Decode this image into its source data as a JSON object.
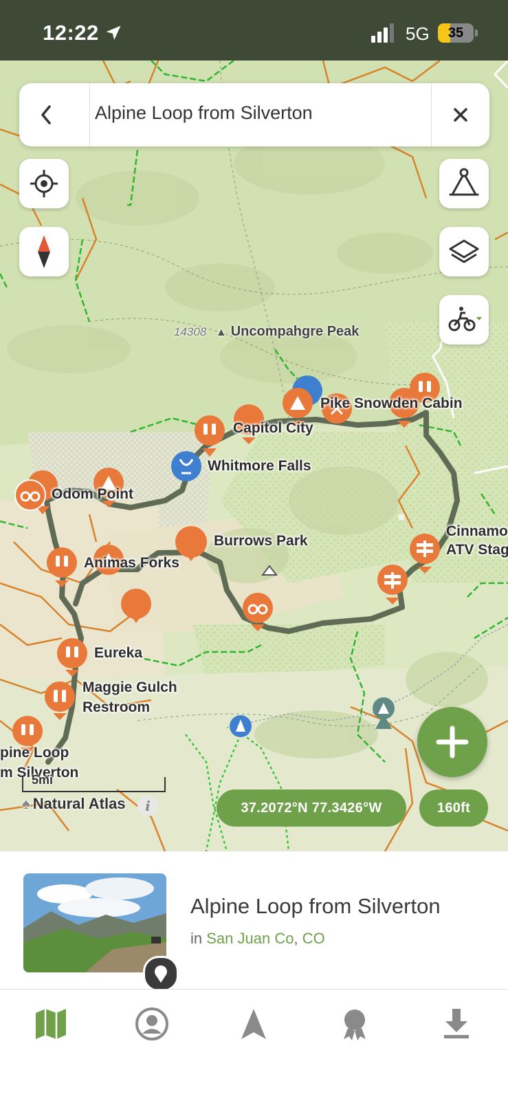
{
  "status_bar": {
    "time": "12:22",
    "network": "5G",
    "battery": "35",
    "battery_level": 0.35
  },
  "search": {
    "title": "Alpine Loop from Silverton"
  },
  "map": {
    "places": {
      "uncompahgre_elev": "14308",
      "uncompahgre": "Uncompahgre Peak",
      "pike_snowden": "Pike Snowden Cabin",
      "capitol_city": "Capitol City",
      "whitmore_falls": "Whitmore Falls",
      "odom_point": "Odom Point",
      "burrows_park": "Burrows Park",
      "cinnamon_line1": "Cinnamon",
      "cinnamon_line2": "ATV Stag",
      "animas_forks": "Animas Forks",
      "eureka": "Eureka",
      "maggie_line1": "Maggie Gulch",
      "maggie_line2": "Restroom",
      "alpine_line1": "pine Loop",
      "alpine_line2": "m Silverton"
    },
    "scale": "5mi",
    "attribution": "Natural Atlas",
    "coordinates": "37.2072°N 77.3426°W",
    "elevation": "160ft",
    "colors": {
      "route": "#5f6b55",
      "marker": "#e8793a",
      "water_marker": "#3f7fd0",
      "accent": "#6fa04a",
      "trail_green": "#2fb52f",
      "road_orange": "#d9822b"
    }
  },
  "card": {
    "name": "Alpine Loop from Silverton",
    "in_label": "in",
    "county": "San Juan Co",
    "separator": ",",
    "state": "CO"
  },
  "tabs": [
    {
      "name": "map",
      "active": true
    },
    {
      "name": "profile",
      "active": false
    },
    {
      "name": "navigate",
      "active": false
    },
    {
      "name": "achievements",
      "active": false
    },
    {
      "name": "downloads",
      "active": false
    }
  ]
}
